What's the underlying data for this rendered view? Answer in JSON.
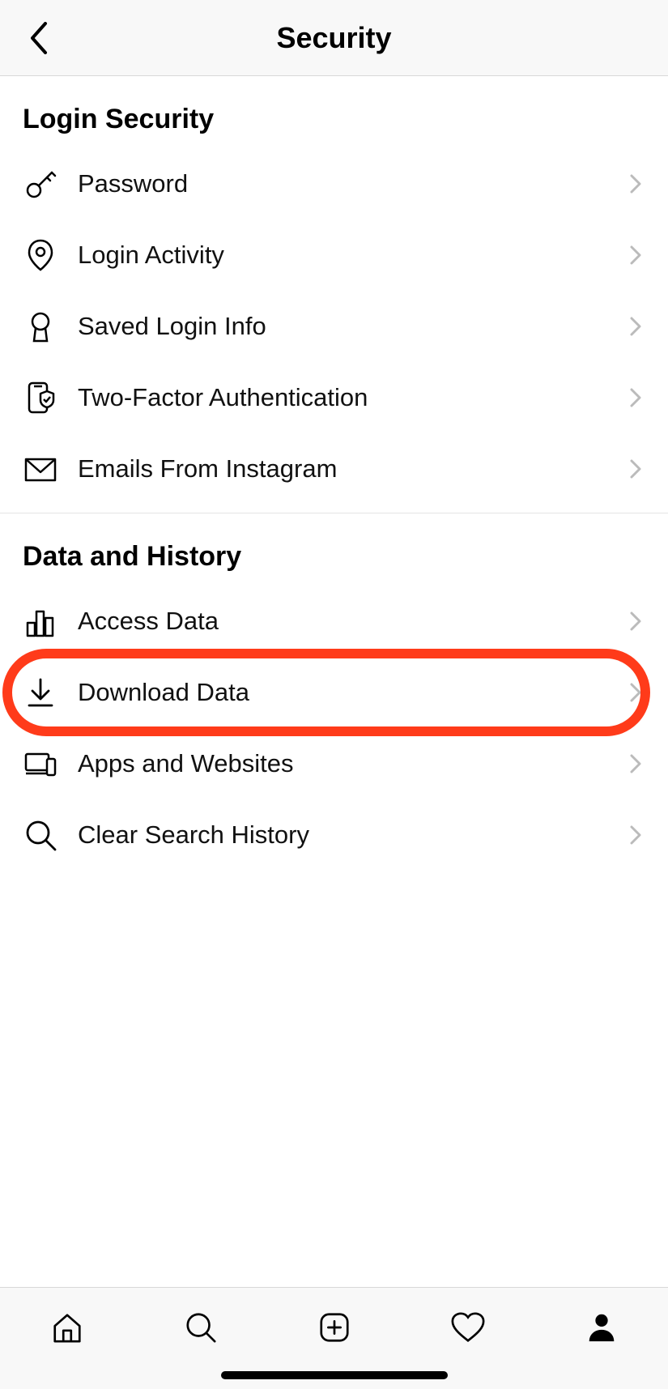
{
  "header": {
    "title": "Security"
  },
  "sections": {
    "login_security": {
      "title": "Login Security",
      "items": {
        "password": "Password",
        "login_activity": "Login Activity",
        "saved_login_info": "Saved Login Info",
        "two_factor": "Two-Factor Authentication",
        "emails": "Emails From Instagram"
      }
    },
    "data_history": {
      "title": "Data and History",
      "items": {
        "access_data": "Access Data",
        "download_data": "Download Data",
        "apps_websites": "Apps and Websites",
        "clear_search": "Clear Search History"
      }
    }
  },
  "highlighted_item": "download_data"
}
